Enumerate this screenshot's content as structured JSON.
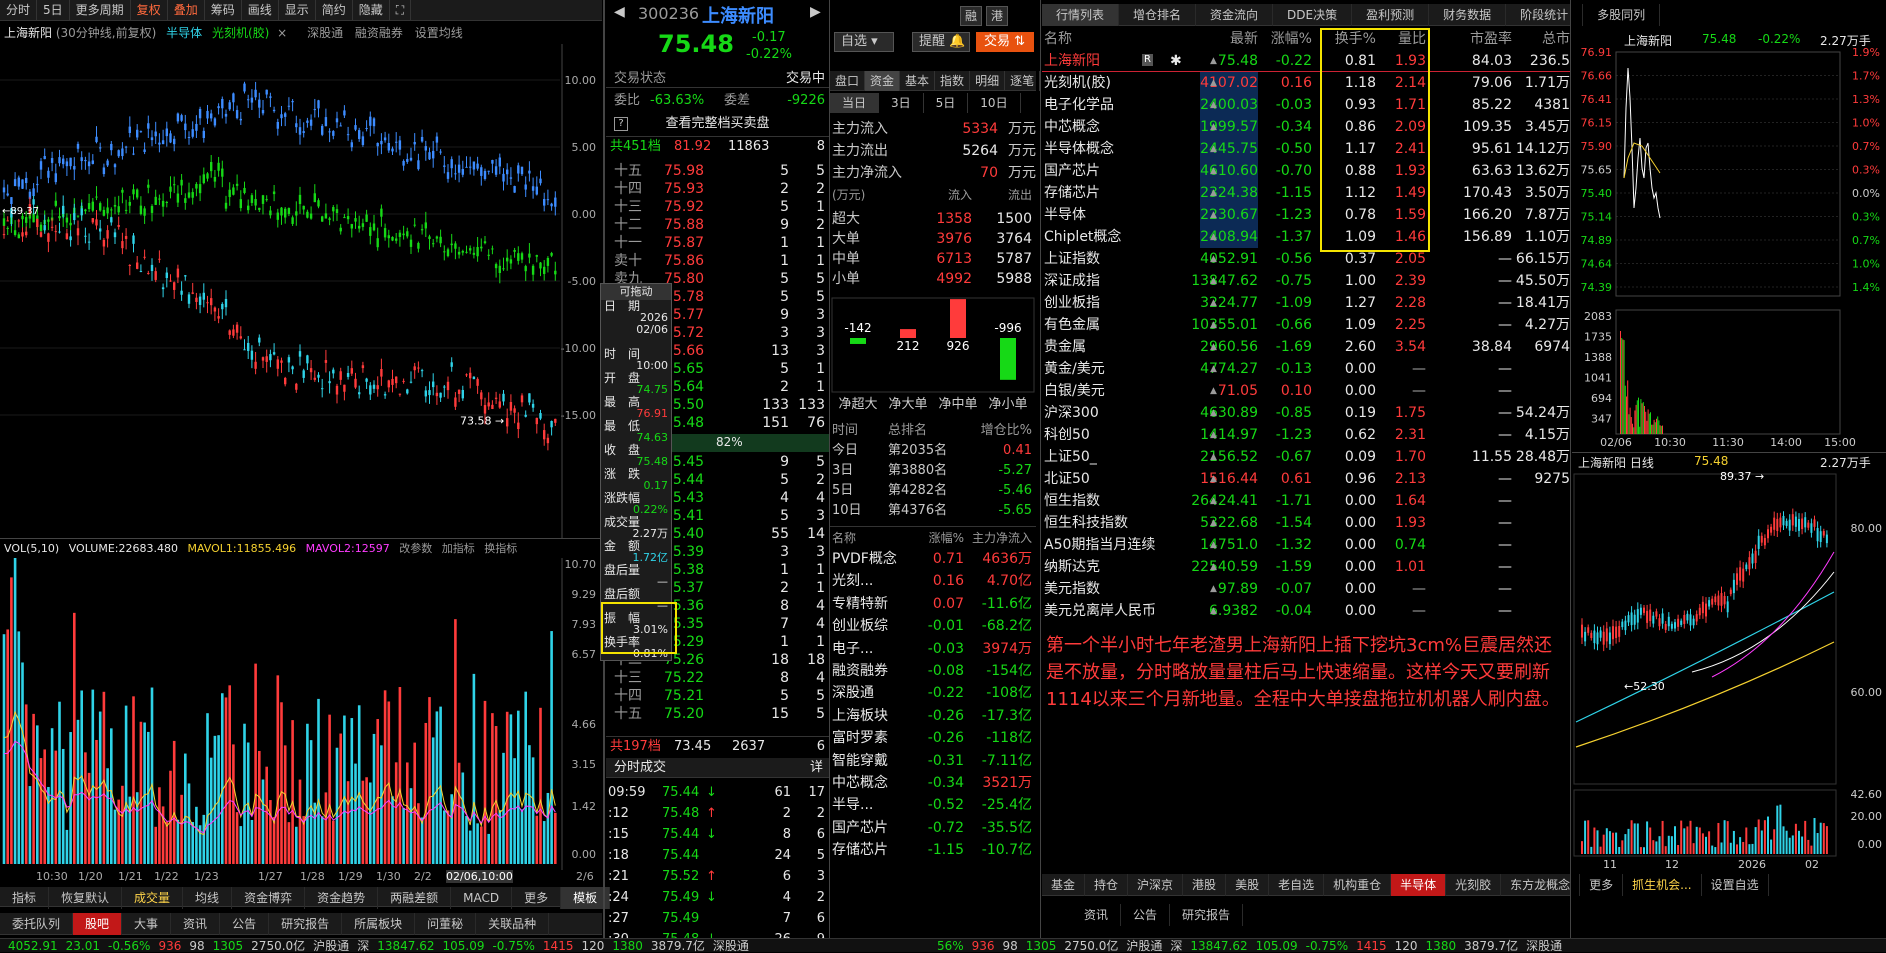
{
  "left": {
    "toolbar": [
      "分时",
      "5日",
      "更多周期",
      "复权",
      "叠加",
      "筹码",
      "画线",
      "显示",
      "简约",
      "隐藏"
    ],
    "title": "上海新阳",
    "subtitle": "(30分钟线,前复权)",
    "overlays": [
      "半导体",
      "光刻机(胶)"
    ],
    "quick": [
      "深股通",
      "融资融券",
      "设置均线"
    ],
    "yaxis": [
      "10.00",
      "5.00",
      "0.00",
      "-5.00",
      "-10.00",
      "-15.00"
    ],
    "low_label": "73.58",
    "start_label": "89.37",
    "xaxis": [
      "10:30",
      "1/20",
      "1/21",
      "1/22",
      "1/23",
      "1/27",
      "1/28",
      "1/29",
      "1/30",
      "2/2",
      "02/06,10:00",
      "2/6"
    ],
    "vol_legend": {
      "a": "VOL(5,10)",
      "b": "VOLUME:22683.480",
      "c": "MAVOL1:11855.496",
      "d": "MAVOL2:12597",
      "e": "改参数",
      "f": "加指标",
      "g": "换指标"
    },
    "vol_axis": [
      "10.70",
      "9.29",
      "7.93",
      "6.57",
      "4.66",
      "3.15",
      "1.42",
      "0.00"
    ],
    "bottom_tabs": [
      "指标",
      "恢复默认",
      "成交量",
      "均线",
      "资金博弈",
      "资金趋势",
      "两融差额",
      "MACD",
      "更多",
      "模板"
    ],
    "bottom_tabs2": [
      "委托队列",
      "股吧",
      "大事",
      "资讯",
      "公告",
      "研究报告",
      "所属板块",
      "问董秘",
      "关联品种"
    ]
  },
  "quote": {
    "code": "300236",
    "name": "上海新阳",
    "tags": [
      "融",
      "港"
    ],
    "price": "75.48",
    "chg": "-0.17",
    "pct": "-0.22%",
    "btns": [
      "自选",
      "提醒",
      "交易"
    ],
    "state_l": "交易状态",
    "state_r": "交易中",
    "wb_l": "委比",
    "wb_v": "-63.63%",
    "wc_l": "委差",
    "wc_v": "-9226",
    "full": "查看完整档买卖盘",
    "sell_total": "共451档",
    "sell_avg": "81.92",
    "sell_vol": "11863",
    "sell_n": "8",
    "asks": [
      [
        "十五",
        "75.98",
        "5",
        "5"
      ],
      [
        "十四",
        "75.93",
        "2",
        "2"
      ],
      [
        "十三",
        "75.92",
        "5",
        "1"
      ],
      [
        "十二",
        "75.88",
        "9",
        "2"
      ],
      [
        "十一",
        "75.87",
        "1",
        "1"
      ],
      [
        "卖十",
        "75.86",
        "1",
        "1"
      ],
      [
        "卖九",
        "75.80",
        "5",
        "5"
      ],
      [
        "卖八",
        "75.78",
        "5",
        "5"
      ],
      [
        "卖七",
        "75.77",
        "9",
        "3"
      ],
      [
        "卖六",
        "75.72",
        "3",
        "3"
      ],
      [
        "卖五",
        "75.66",
        "13",
        "3"
      ],
      [
        "卖四",
        "75.65",
        "5",
        "1"
      ],
      [
        "卖三",
        "75.64",
        "2",
        "1"
      ],
      [
        "卖二",
        "75.50",
        "133",
        "133"
      ],
      [
        "卖一",
        "75.48",
        "151",
        "76"
      ]
    ],
    "bar_pct": "82%",
    "bids": [
      [
        "买一",
        "75.45",
        "9",
        "5"
      ],
      [
        "买二",
        "75.44",
        "5",
        "2"
      ],
      [
        "买三",
        "75.43",
        "4",
        "4"
      ],
      [
        "买四",
        "75.41",
        "5",
        "3"
      ],
      [
        "买五",
        "75.40",
        "55",
        "14"
      ],
      [
        "买六",
        "75.39",
        "3",
        "3"
      ],
      [
        "买七",
        "75.38",
        "1",
        "1"
      ],
      [
        "买八",
        "75.37",
        "2",
        "1"
      ],
      [
        "买九",
        "75.36",
        "8",
        "4"
      ],
      [
        "买十",
        "75.35",
        "7",
        "4"
      ],
      [
        "十一",
        "75.29",
        "1",
        "1"
      ],
      [
        "十二",
        "75.26",
        "18",
        "18"
      ],
      [
        "十三",
        "75.22",
        "8",
        "4"
      ],
      [
        "十四",
        "75.21",
        "5",
        "5"
      ],
      [
        "十五",
        "75.20",
        "15",
        "5"
      ]
    ],
    "buy_total": "共197档",
    "buy_avg": "73.45",
    "buy_vol": "2637",
    "buy_n": "6",
    "tip": {
      "hdr": "可拖动",
      "date_l": "日　期",
      "date1": "2026",
      "date2": "02/06",
      "time_l": "时　间",
      "time": "10:00",
      "open_l": "开　盘",
      "open": "74.75",
      "high_l": "最　高",
      "high": "76.91",
      "low_l": "最　低",
      "low": "74.63",
      "close_l": "收　盘",
      "close": "75.48",
      "chg_l": "涨　跌",
      "chg": "0.17",
      "pct_l": "涨跌幅",
      "pct": "0.22%",
      "vol_l": "成交量",
      "vol": "2.27万",
      "amt_l": "金　额",
      "amt": "1.72亿",
      "ah_l": "盘后量",
      "ah": "—",
      "aa_l": "盘后额",
      "aa": "—",
      "amp_l": "振　幅",
      "amp": "3.01%",
      "turn_l": "换手率",
      "turn": "0.81%"
    },
    "ticks_hdr": "分时成交",
    "ticks_btn": "详",
    "ticks": [
      [
        "09:59",
        "75.44",
        "↓",
        "61",
        "17"
      ],
      [
        ":12",
        "75.48",
        "↑",
        "2",
        "2"
      ],
      [
        ":15",
        "75.44",
        "↓",
        "8",
        "6"
      ],
      [
        ":18",
        "75.44",
        "",
        "24",
        "5"
      ],
      [
        ":21",
        "75.52",
        "↑",
        "6",
        "3"
      ],
      [
        ":24",
        "75.49",
        "↓",
        "4",
        "2"
      ],
      [
        ":27",
        "75.49",
        "",
        "7",
        "6"
      ],
      [
        ":30",
        "75.48",
        "↓",
        "26",
        "9"
      ]
    ]
  },
  "fund": {
    "tabs": [
      "盘口",
      "资金",
      "基本",
      "指数",
      "明细",
      "逐笔"
    ],
    "period": [
      "当日",
      "3日",
      "5日",
      "10日"
    ],
    "main_in_l": "主力流入",
    "main_in": "5334",
    "main_out_l": "主力流出",
    "main_out": "5264",
    "main_net_l": "主力净流入",
    "main_net": "70",
    "unit": "万元",
    "flow_hdr": [
      "(万元)",
      "流入",
      "流出"
    ],
    "flows": [
      [
        "超大",
        "1358",
        "1500"
      ],
      [
        "大单",
        "3976",
        "3764"
      ],
      [
        "中单",
        "6713",
        "5787"
      ],
      [
        "小单",
        "4992",
        "5988"
      ]
    ],
    "bars_val": [
      "-142",
      "212",
      "926",
      "-996"
    ],
    "bars_lbl": [
      "净超大",
      "净大单",
      "净中单",
      "净小单"
    ],
    "rank_hdr": [
      "时间",
      "总排名",
      "增仓比%"
    ],
    "ranks": [
      [
        "今日",
        "第2035名",
        "0.41"
      ],
      [
        "3日",
        "第3880名",
        "-5.27"
      ],
      [
        "5日",
        "第4282名",
        "-5.46"
      ],
      [
        "10日",
        "第4376名",
        "-5.65"
      ]
    ],
    "sect_hdr": [
      "名称",
      "涨幅%",
      "主力净流入"
    ],
    "sects": [
      [
        "PVDF概念",
        "0.71",
        "4636万"
      ],
      [
        "光刻...",
        "0.16",
        "4.70亿"
      ],
      [
        "专精特新",
        "0.07",
        "-11.6亿"
      ],
      [
        "创业板综",
        "-0.01",
        "-68.2亿"
      ],
      [
        "电子...",
        "-0.03",
        "3974万"
      ],
      [
        "融资融券",
        "-0.08",
        "-154亿"
      ],
      [
        "深股通",
        "-0.22",
        "-108亿"
      ],
      [
        "上海板块",
        "-0.26",
        "-17.3亿"
      ],
      [
        "富时罗素",
        "-0.26",
        "-118亿"
      ],
      [
        "智能穿戴",
        "-0.31",
        "-7.11亿"
      ],
      [
        "中芯概念",
        "-0.34",
        "3521万"
      ],
      [
        "半导...",
        "-0.52",
        "-25.4亿"
      ],
      [
        "国产芯片",
        "-0.72",
        "-35.5亿"
      ],
      [
        "存储芯片",
        "-1.15",
        "-10.7亿"
      ]
    ]
  },
  "mkt": {
    "tabs": [
      "行情列表",
      "增仓排名",
      "资金流向",
      "DDE决策",
      "盈利预测",
      "财务数据",
      "阶段统计",
      "多股同列"
    ],
    "hdr": [
      "名称",
      "最新",
      "涨幅%",
      "换手%",
      "量比",
      "市盈率",
      "总市"
    ],
    "rows": [
      [
        "上海新阳",
        "75.48",
        "-0.22",
        "0.81",
        "1.93",
        "84.03",
        "236.5"
      ],
      [
        "光刻机(胶)",
        "4107.02",
        "0.16",
        "1.18",
        "2.14",
        "79.06",
        "1.71万"
      ],
      [
        "电子化学品",
        "2400.03",
        "-0.03",
        "0.93",
        "1.71",
        "85.22",
        "4381"
      ],
      [
        "中芯概念",
        "1999.57",
        "-0.34",
        "0.86",
        "2.09",
        "109.35",
        "3.45万"
      ],
      [
        "半导体概念",
        "2445.75",
        "-0.50",
        "1.17",
        "2.41",
        "95.61",
        "14.12万"
      ],
      [
        "国产芯片",
        "4610.60",
        "-0.70",
        "0.88",
        "1.93",
        "63.63",
        "13.62万"
      ],
      [
        "存储芯片",
        "2324.38",
        "-1.15",
        "1.12",
        "1.49",
        "170.43",
        "3.50万"
      ],
      [
        "半导体",
        "2230.67",
        "-1.23",
        "0.78",
        "1.59",
        "166.20",
        "7.87万"
      ],
      [
        "Chiplet概念",
        "2408.94",
        "-1.37",
        "1.09",
        "1.46",
        "156.89",
        "1.10万"
      ],
      [
        "上证指数",
        "4052.91",
        "-0.56",
        "0.37",
        "2.05",
        "—",
        "66.15万"
      ],
      [
        "深证成指",
        "13847.62",
        "-0.75",
        "1.00",
        "2.39",
        "—",
        "45.50万"
      ],
      [
        "创业板指",
        "3224.77",
        "-1.09",
        "1.27",
        "2.28",
        "—",
        "18.41万"
      ],
      [
        "有色金属",
        "10355.01",
        "-0.66",
        "1.09",
        "2.25",
        "—",
        "4.27万"
      ],
      [
        "贵金属",
        "2960.56",
        "-1.69",
        "2.60",
        "3.54",
        "38.84",
        "6974"
      ],
      [
        "黄金/美元",
        "4774.27",
        "-0.13",
        "0.00",
        "—",
        "—",
        ""
      ],
      [
        "白银/美元",
        "71.05",
        "0.10",
        "0.00",
        "—",
        "—",
        ""
      ],
      [
        "沪深300",
        "4630.89",
        "-0.85",
        "0.19",
        "1.75",
        "—",
        "54.24万"
      ],
      [
        "科创50",
        "1414.97",
        "-1.23",
        "0.62",
        "2.31",
        "—",
        "4.15万"
      ],
      [
        "上证50_",
        "2156.52",
        "-0.67",
        "0.09",
        "1.70",
        "11.55",
        "28.48万"
      ],
      [
        "北证50",
        "1516.44",
        "0.61",
        "0.96",
        "2.13",
        "—",
        "9275"
      ],
      [
        "恒生指数",
        "26424.41",
        "-1.71",
        "0.00",
        "1.64",
        "—",
        ""
      ],
      [
        "恒生科技指数",
        "5322.68",
        "-1.54",
        "0.00",
        "1.93",
        "—",
        ""
      ],
      [
        "A50期指当月连续",
        "14751.0",
        "-1.32",
        "0.00",
        "0.74",
        "—",
        ""
      ],
      [
        "纳斯达克",
        "22540.59",
        "-1.59",
        "0.00",
        "1.01",
        "—",
        ""
      ],
      [
        "美元指数",
        "97.89",
        "-0.07",
        "0.00",
        "—",
        "—",
        ""
      ],
      [
        "美元兑离岸人民币",
        "6.9382",
        "-0.04",
        "0.00",
        "—",
        "—",
        ""
      ]
    ],
    "note": "第一个半小时七年老渣男上海新阳上插下挖坑3cm%巨震居然还是不放量，分时略放量量柱后马上快速缩量。这样今天又要刷新1114以来三个月新地量。全程中大单接盘拖拉机机器人刷内盘。",
    "bottom_tabs": [
      "基金",
      "持仓",
      "沪深京",
      "港股",
      "美股",
      "老自选",
      "机构重仓",
      "半导体",
      "光刻胶",
      "东方龙概念",
      "更多",
      "抓生机会...",
      "设置自选"
    ],
    "sub_tabs": [
      "资讯",
      "公告",
      "研究报告"
    ]
  },
  "mini": {
    "name": "上海新阳",
    "price": "75.48",
    "pct": "-0.22%",
    "vol": "2.27万手",
    "laxis": [
      "76.91",
      "76.66",
      "76.41",
      "76.15",
      "75.90",
      "75.65",
      "75.40",
      "75.14",
      "74.89",
      "74.64",
      "74.39"
    ],
    "raxis": [
      "1.9%",
      "1.7%",
      "1.3%",
      "1.0%",
      "0.7%",
      "0.3%",
      "0.0%",
      "0.3%",
      "0.7%",
      "1.0%",
      "1.4%"
    ],
    "vaxis": [
      "2083",
      "1735",
      "1388",
      "1041",
      "694",
      "347"
    ],
    "xaxis": [
      "02/06",
      "10:30",
      "11:30",
      "14:00",
      "15:00"
    ],
    "day_name": "上海新阳 日线",
    "day_price": "75.48",
    "day_vol": "2.27万手",
    "day_hi": "89.37",
    "day_lo": "52.30",
    "day_axis": [
      "80.00",
      "60.00"
    ],
    "dvol_axis": [
      "42.60",
      "20.00",
      "0.00"
    ],
    "dx": [
      "11",
      "12",
      "2026",
      "02"
    ]
  },
  "status": {
    "items": [
      "4052.91",
      "23.01",
      "-0.56%",
      "936",
      "98",
      "1305",
      "2750.0亿",
      "沪股通",
      "深",
      "13847.62",
      "105.09",
      "-0.75%",
      "1415",
      "120",
      "1380",
      "3879.7亿",
      "深股通"
    ],
    "right": [
      "56%",
      "936",
      "98",
      "1305",
      "2750.0亿",
      "沪股通",
      "深",
      "13847.62",
      "105.09",
      "-0.75%",
      "1415",
      "120",
      "1380",
      "3879.7亿",
      "深股通"
    ]
  }
}
